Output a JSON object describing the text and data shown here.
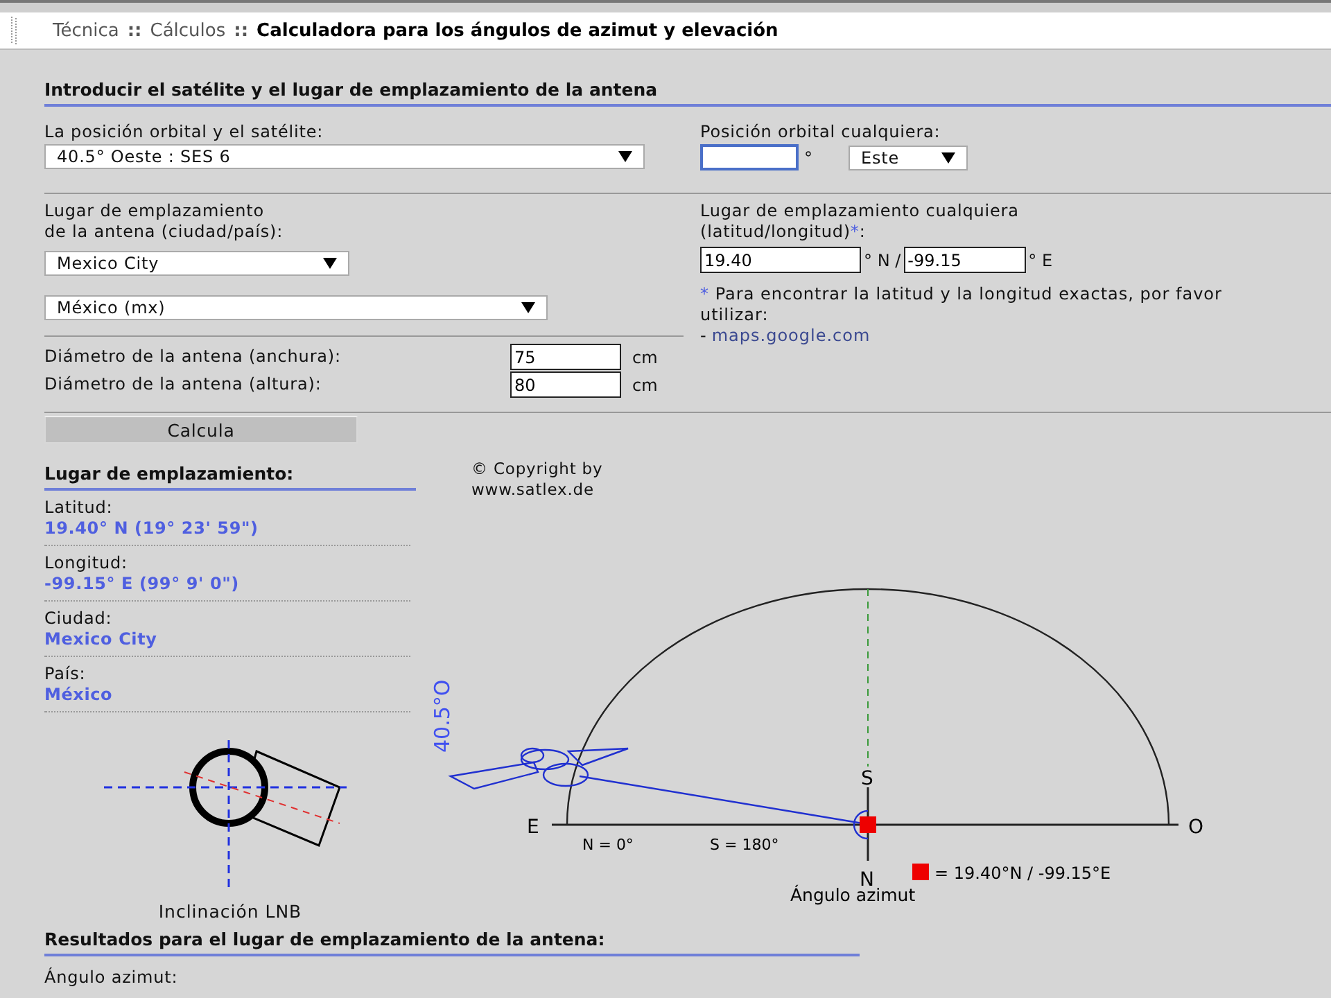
{
  "breadcrumb": [
    {
      "kind": "link",
      "text": "Técnica"
    },
    {
      "kind": "separator",
      "text": "::"
    },
    {
      "kind": "link",
      "text": "Cálculos"
    },
    {
      "kind": "separator",
      "text": "::"
    },
    {
      "kind": "current",
      "text": "Calculadora para los ángulos de azimut y elevación"
    }
  ],
  "input_section": {
    "title": "Introducir el satélite y el lugar de emplazamiento de la antena",
    "satellite": {
      "label": "La posición orbital y el satélite:",
      "value": "40.5° Oeste : SES 6"
    },
    "custom_position": {
      "label": "Posición orbital cualquiera:",
      "unit": "°",
      "direction": "Este"
    },
    "location": {
      "label_lines": [
        "Lugar de emplazamiento",
        "de la antena (ciudad/país):"
      ],
      "city": "Mexico City",
      "country": "México (mx)"
    },
    "custom_location": {
      "label_lines": [
        "Lugar de emplazamiento cualquiera",
        "(latitud/longitud)"
      ],
      "asterisk": "*",
      "suffix": ":",
      "latitude": "19.40",
      "latitude_unit": "° N /",
      "longitude": "-99.15",
      "longitude_unit": "° E"
    },
    "note": {
      "asterisk": "*",
      "text": "Para encontrar la latitud y la longitud exactas, por favor utilizar:",
      "dash": "-",
      "link": "maps.google.com"
    },
    "diameters": [
      {
        "label": "Diámetro de la antena (anchura):",
        "value": "75",
        "unit": "cm"
      },
      {
        "label": "Diámetro de la antena (altura):",
        "value": "80",
        "unit": "cm"
      }
    ],
    "button": "Calcula"
  },
  "location_panel": {
    "title": "Lugar de emplazamiento:",
    "items": [
      {
        "label": "Latitud:",
        "value": "19.40° N (19° 23' 59\")"
      },
      {
        "label": "Longitud:",
        "value": "-99.15° E (99° 9' 0\")"
      },
      {
        "label": "Ciudad:",
        "value": "Mexico City"
      },
      {
        "label": "País:",
        "value": "México"
      }
    ],
    "lnb_caption": "Inclinación LNB"
  },
  "diagram": {
    "copyright_lines": [
      "© Copyright by",
      "www.satlex.de"
    ],
    "satellite_label": "40.5°O",
    "east": "E",
    "west": "O",
    "south": "S",
    "north": "N",
    "north_value": "N = 0°",
    "south_value": "S = 180°",
    "legend": "= 19.40°N / -99.15°E",
    "caption": "Ángulo azimut"
  },
  "results": {
    "title": "Resultados para el lugar de emplazamiento de la antena:",
    "items": [
      {
        "label": "Ángulo azimut:"
      }
    ]
  }
}
